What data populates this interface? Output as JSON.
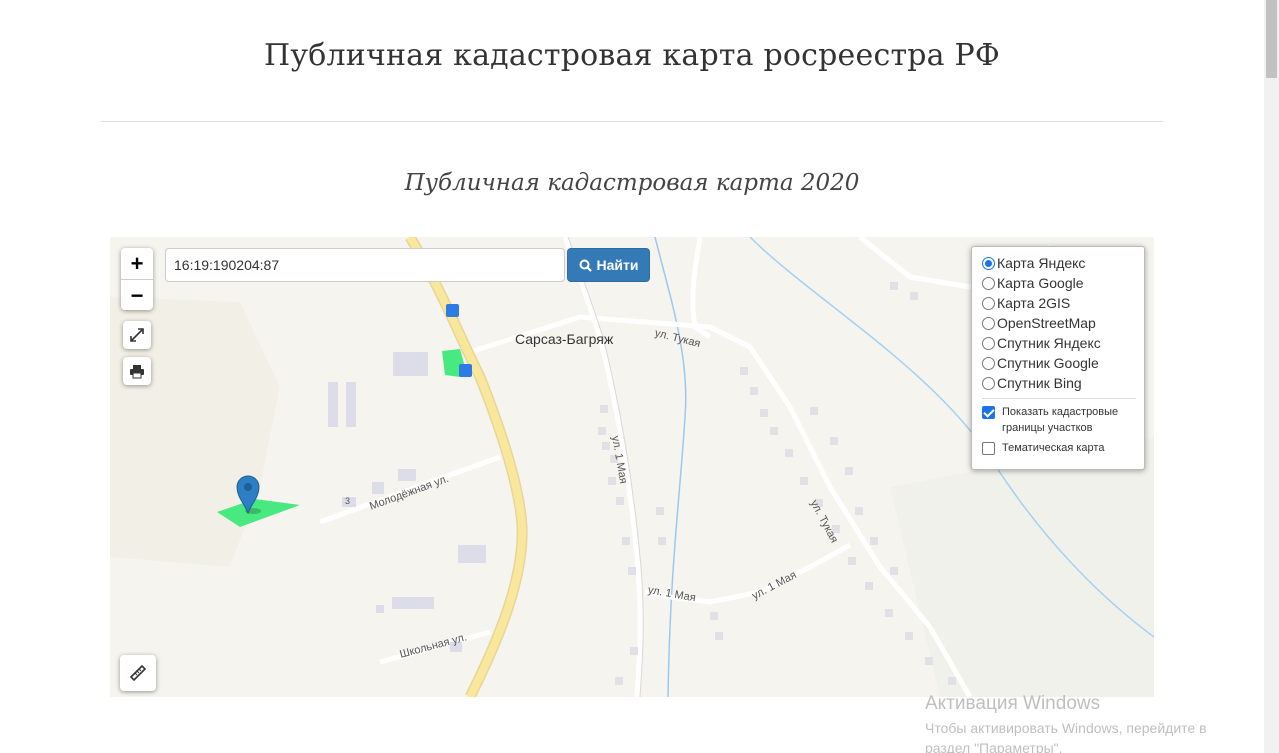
{
  "page": {
    "title": "Публичная кадастровая карта росреестра РФ",
    "subtitle": "Публичная кадастровая карта 2020"
  },
  "map": {
    "search": {
      "value": "16:19:190204:87",
      "button_label": "Найти"
    },
    "zoom": {
      "in_label": "+",
      "out_label": "−"
    },
    "village_label": "Сарсаз-Багряж",
    "street_labels": {
      "tukaya_top": "ул. Тукая",
      "tukaya_right": "ул. Тукая",
      "may1_vertical": "ул. 1 Мая",
      "may1_bottom": "ул. 1 Мая",
      "may1_bottom2": "ул. 1 Мая",
      "molodezhnaya": "Молодёжная ул.",
      "shkolnaya": "Школьная ул.",
      "house_number": "3"
    },
    "layers": {
      "options": [
        "Карта Яндекс",
        "Карта Google",
        "Карта 2GIS",
        "OpenStreetMap",
        "Спутник Яндекс",
        "Спутник Google",
        "Спутник Bing"
      ],
      "selected": "Карта Яндекс",
      "show_cadastral_label": "Показать кадастровые границы участков",
      "show_cadastral_checked": true,
      "thematic_label": "Тематическая карта",
      "thematic_checked": false
    },
    "colors": {
      "parcel": "#3fe87a",
      "road_main": "#f7e08a",
      "accent": "#337ab7",
      "marker": "#2c7fc4"
    }
  },
  "overlay": {
    "windows_title": "Активация Windows",
    "windows_text": "Чтобы активировать Windows, перейдите в раздел \"Параметры\"."
  }
}
